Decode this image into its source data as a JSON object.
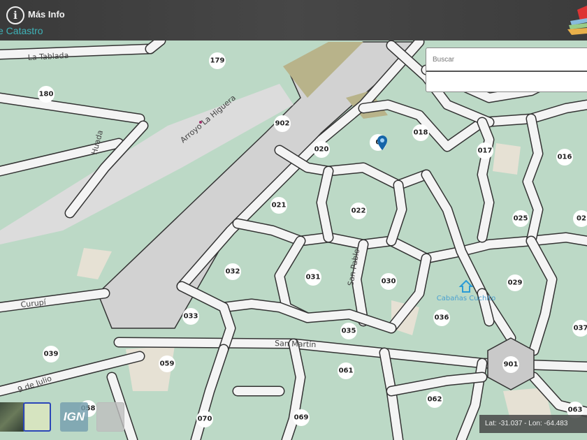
{
  "header": {
    "info_icon": "i",
    "info_label": "Más Info",
    "subtitle": "e Catastro"
  },
  "search": {
    "placeholder": "Buscar"
  },
  "coords": {
    "text": "Lat: -31.037 - Lon: -64.483"
  },
  "layers": [
    {
      "name": "satellite"
    },
    {
      "name": "street-map",
      "selected": true
    },
    {
      "name": "ign",
      "label": "IGN"
    },
    {
      "name": "plain"
    }
  ],
  "streets": [
    "La Tablada",
    "Huada",
    "Arroyo La Higuera",
    "Curupí",
    "San Martín",
    "San Pablo",
    "9 de Julio"
  ],
  "poi": {
    "label": "Cabañas Cuchito"
  },
  "plots": [
    "179",
    "180",
    "902",
    "020",
    "0",
    "018",
    "017",
    "016",
    "021",
    "022",
    "025",
    "02",
    "032",
    "031",
    "030",
    "029",
    "033",
    "035",
    "036",
    "037",
    "039",
    "059",
    "061",
    "901",
    "062",
    "063",
    "070",
    "069",
    "058"
  ],
  "colors": {
    "parcel": "#bcd9c6",
    "street": "#f4f4f4",
    "river_area": "#d4d4d4",
    "topbar": "#444444",
    "accent": "#3fb3b8",
    "pin": "#1565a8"
  }
}
